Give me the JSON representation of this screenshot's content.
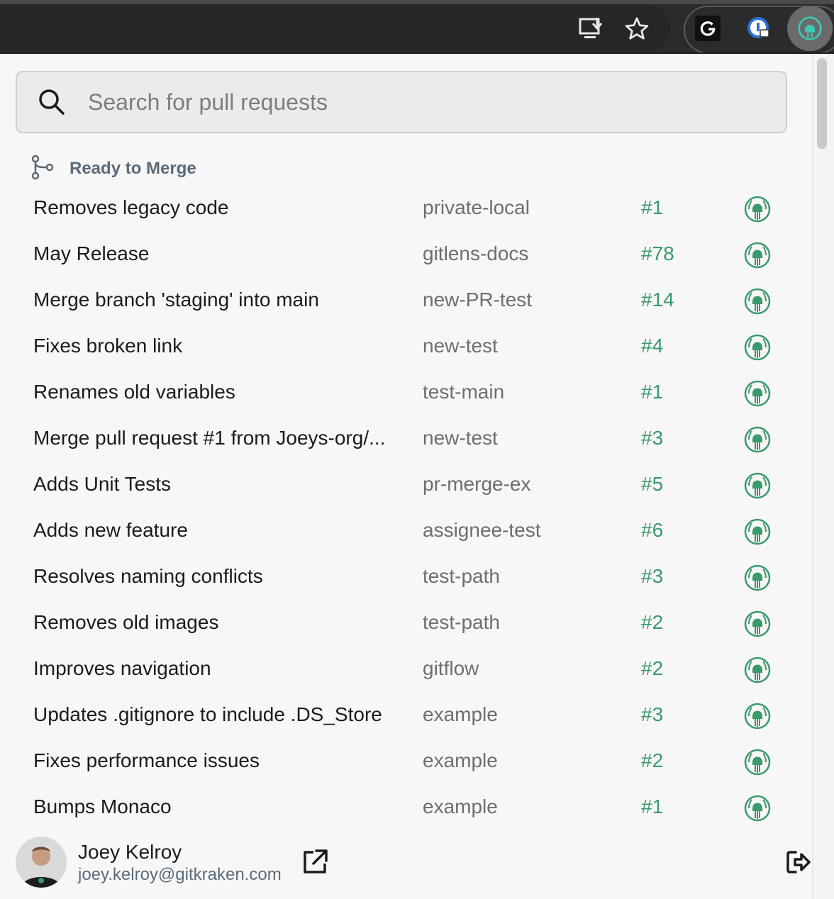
{
  "search": {
    "placeholder": "Search for pull requests",
    "value": ""
  },
  "section": {
    "label": "Ready to Merge",
    "icon": "git-merge-icon"
  },
  "pull_requests": [
    {
      "title": "Removes legacy code",
      "repo": "private-local",
      "number": "#1"
    },
    {
      "title": "May Release",
      "repo": "gitlens-docs",
      "number": "#78"
    },
    {
      "title": "Merge branch 'staging' into main",
      "repo": "new-PR-test",
      "number": "#14"
    },
    {
      "title": "Fixes broken link",
      "repo": "new-test",
      "number": "#4"
    },
    {
      "title": "Renames old variables",
      "repo": "test-main",
      "number": "#1"
    },
    {
      "title": "Merge pull request #1 from Joeys-org/...",
      "repo": "new-test",
      "number": "#3"
    },
    {
      "title": "Adds Unit Tests",
      "repo": "pr-merge-ex",
      "number": "#5"
    },
    {
      "title": "Adds new feature",
      "repo": "assignee-test",
      "number": "#6"
    },
    {
      "title": "Resolves naming conflicts",
      "repo": "test-path",
      "number": "#3"
    },
    {
      "title": "Removes old images",
      "repo": "test-path",
      "number": "#2"
    },
    {
      "title": "Improves navigation",
      "repo": "gitflow",
      "number": "#2"
    },
    {
      "title": "Updates .gitignore to include .DS_Store",
      "repo": "example",
      "number": "#3"
    },
    {
      "title": "Fixes performance issues",
      "repo": "example",
      "number": "#2"
    },
    {
      "title": "Bumps Monaco",
      "repo": "example",
      "number": "#1"
    }
  ],
  "user": {
    "name": "Joey Kelroy",
    "email": "joey.kelroy@gitkraken.com"
  },
  "colors": {
    "accent": "#3a9a6a",
    "section_label": "#5b6b79",
    "repo_text": "#6e6e6e",
    "toolbar_bg": "#2b2b2b"
  },
  "toolbar_icons": [
    "install-app-icon",
    "bookmark-star-icon",
    "grammarly-icon",
    "password-manager-icon",
    "gitkraken-extension-icon"
  ],
  "row_icon": "gitkraken-logo-icon"
}
